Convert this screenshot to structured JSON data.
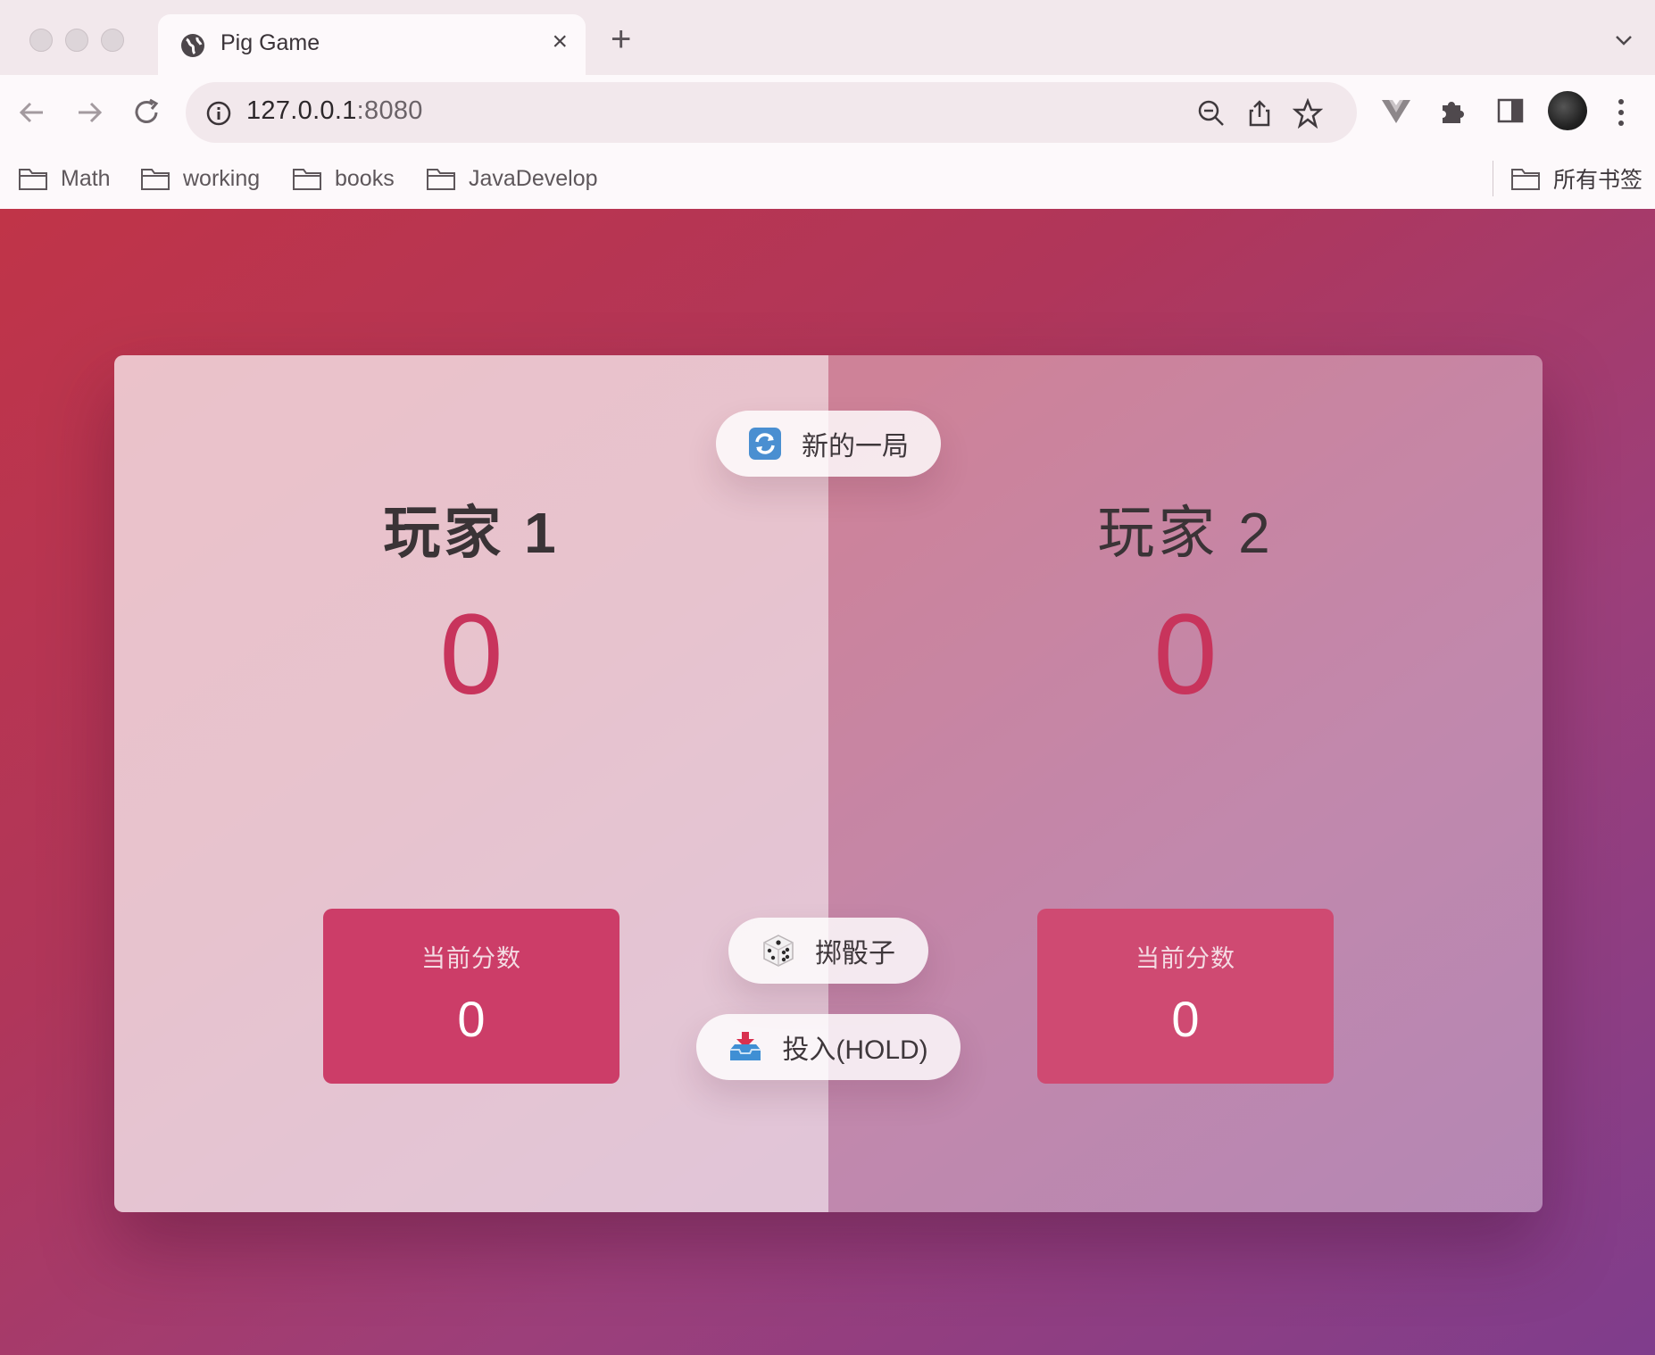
{
  "browser": {
    "tab_title": "Pig Game",
    "new_tab_symbol": "+",
    "close_symbol": "×",
    "url_host": "127.0.0.1",
    "url_port": ":8080",
    "bookmarks": [
      "Math",
      "working",
      "books",
      "JavaDevelop"
    ],
    "all_bookmarks": "所有书签",
    "icons": [
      "globe-icon",
      "back-arrow-icon",
      "forward-arrow-icon",
      "reload-icon",
      "info-icon",
      "zoom-out-icon",
      "share-icon",
      "star-icon",
      "vue-devtools-icon",
      "extensions-puzzle-icon",
      "side-panel-icon",
      "avatar",
      "kebab-menu-icon",
      "folder-icon",
      "chevron-down-icon"
    ]
  },
  "game": {
    "new_game_label": "新的一局",
    "roll_label": "掷骰子",
    "hold_label": "投入(HOLD)",
    "players": [
      {
        "name": "玩家 1",
        "score": "0",
        "current_label": "当前分数",
        "current": "0",
        "active": true
      },
      {
        "name": "玩家 2",
        "score": "0",
        "current_label": "当前分数",
        "current": "0",
        "active": false
      }
    ],
    "colors": {
      "score": "#c8345c",
      "current_box": "#cc3d68",
      "background_start": "#c03448",
      "background_end": "#7f3d8c"
    },
    "button_icons": [
      "refresh-emoji-icon",
      "dice-emoji-icon",
      "inbox-tray-emoji-icon"
    ]
  }
}
